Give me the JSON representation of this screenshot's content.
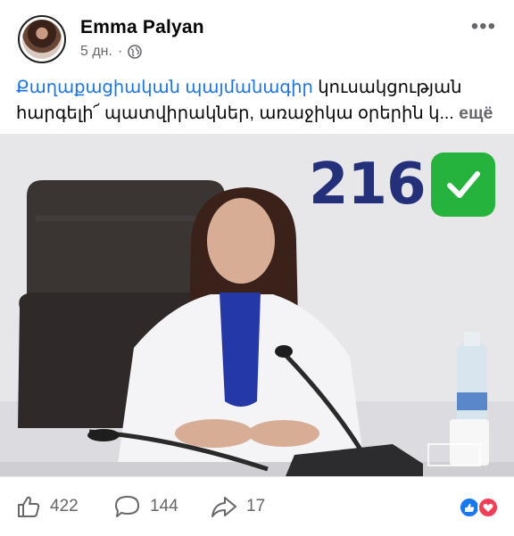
{
  "post": {
    "author": "Emma  Palyan",
    "time": "5 дн.",
    "separator": "·",
    "caption_link": "Քաղաքացիական պայմանագիր",
    "caption_rest": " կուսակցության հարգելի՜ պատվիրակներ, առաջիկա օրերին կ...",
    "see_more": "ещё"
  },
  "image": {
    "count": "216",
    "check_color": "#25b33e",
    "count_color": "#25307a"
  },
  "actions": {
    "likes": "422",
    "comments": "144",
    "shares": "17"
  },
  "colors": {
    "link": "#1b74e4",
    "muted": "#65676b",
    "like_blue": "#1877f2",
    "love_red": "#f33e58"
  }
}
